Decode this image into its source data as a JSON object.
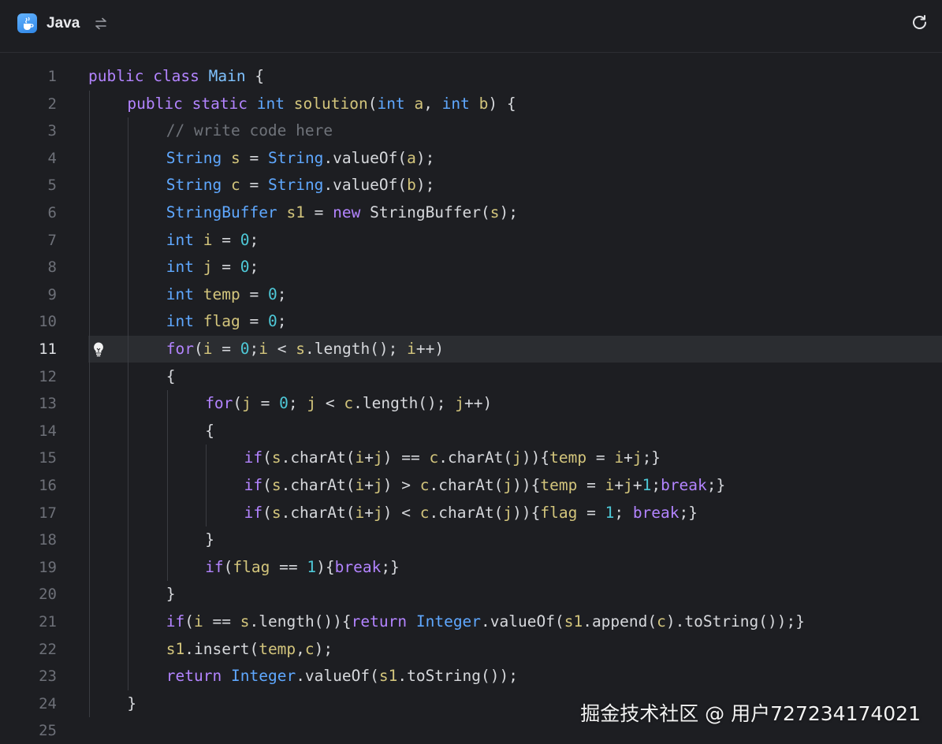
{
  "header": {
    "language_label": "Java",
    "language_icon": "java-cup-icon",
    "switch_icon": "swap-arrows-icon",
    "reset_icon": "refresh-icon"
  },
  "editor": {
    "current_line": 11,
    "hint_icon": "lightbulb-icon",
    "lines": [
      {
        "n": "1",
        "indent": 0,
        "tokens": [
          [
            "kw",
            "public"
          ],
          [
            "pl",
            " "
          ],
          [
            "kw",
            "class"
          ],
          [
            "pl",
            " "
          ],
          [
            "cls",
            "Main"
          ],
          [
            "pl",
            " {"
          ]
        ]
      },
      {
        "n": "2",
        "indent": 1,
        "tokens": [
          [
            "kw",
            "public"
          ],
          [
            "pl",
            " "
          ],
          [
            "kw",
            "static"
          ],
          [
            "pl",
            " "
          ],
          [
            "type",
            "int"
          ],
          [
            "pl",
            " "
          ],
          [
            "fn",
            "solution"
          ],
          [
            "pl",
            "("
          ],
          [
            "type",
            "int"
          ],
          [
            "pl",
            " "
          ],
          [
            "var",
            "a"
          ],
          [
            "pl",
            ", "
          ],
          [
            "type",
            "int"
          ],
          [
            "pl",
            " "
          ],
          [
            "var",
            "b"
          ],
          [
            "pl",
            ") {"
          ]
        ]
      },
      {
        "n": "3",
        "indent": 2,
        "tokens": [
          [
            "cm",
            "// write code here"
          ]
        ]
      },
      {
        "n": "4",
        "indent": 2,
        "tokens": [
          [
            "type",
            "String"
          ],
          [
            "pl",
            " "
          ],
          [
            "var",
            "s"
          ],
          [
            "pl",
            " = "
          ],
          [
            "type",
            "String"
          ],
          [
            "pl",
            ".valueOf("
          ],
          [
            "var",
            "a"
          ],
          [
            "pl",
            ");"
          ]
        ]
      },
      {
        "n": "5",
        "indent": 2,
        "tokens": [
          [
            "type",
            "String"
          ],
          [
            "pl",
            " "
          ],
          [
            "var",
            "c"
          ],
          [
            "pl",
            " = "
          ],
          [
            "type",
            "String"
          ],
          [
            "pl",
            ".valueOf("
          ],
          [
            "var",
            "b"
          ],
          [
            "pl",
            ");"
          ]
        ]
      },
      {
        "n": "6",
        "indent": 2,
        "tokens": [
          [
            "type",
            "StringBuffer"
          ],
          [
            "pl",
            " "
          ],
          [
            "var",
            "s1"
          ],
          [
            "pl",
            " = "
          ],
          [
            "kw",
            "new"
          ],
          [
            "pl",
            " StringBuffer("
          ],
          [
            "var",
            "s"
          ],
          [
            "pl",
            ");"
          ]
        ]
      },
      {
        "n": "7",
        "indent": 2,
        "tokens": [
          [
            "type",
            "int"
          ],
          [
            "pl",
            " "
          ],
          [
            "var",
            "i"
          ],
          [
            "pl",
            " = "
          ],
          [
            "num",
            "0"
          ],
          [
            "pl",
            ";"
          ]
        ]
      },
      {
        "n": "8",
        "indent": 2,
        "tokens": [
          [
            "type",
            "int"
          ],
          [
            "pl",
            " "
          ],
          [
            "var",
            "j"
          ],
          [
            "pl",
            " = "
          ],
          [
            "num",
            "0"
          ],
          [
            "pl",
            ";"
          ]
        ]
      },
      {
        "n": "9",
        "indent": 2,
        "tokens": [
          [
            "type",
            "int"
          ],
          [
            "pl",
            " "
          ],
          [
            "var",
            "temp"
          ],
          [
            "pl",
            " = "
          ],
          [
            "num",
            "0"
          ],
          [
            "pl",
            ";"
          ]
        ]
      },
      {
        "n": "10",
        "indent": 2,
        "tokens": [
          [
            "type",
            "int"
          ],
          [
            "pl",
            " "
          ],
          [
            "var",
            "flag"
          ],
          [
            "pl",
            " = "
          ],
          [
            "num",
            "0"
          ],
          [
            "pl",
            ";"
          ]
        ]
      },
      {
        "n": "11",
        "indent": 2,
        "tokens": [
          [
            "kw",
            "for"
          ],
          [
            "pl",
            "("
          ],
          [
            "var",
            "i"
          ],
          [
            "pl",
            " = "
          ],
          [
            "num",
            "0"
          ],
          [
            "pl",
            ";"
          ],
          [
            "var",
            "i"
          ],
          [
            "pl",
            " < "
          ],
          [
            "var",
            "s"
          ],
          [
            "pl",
            ".length(); "
          ],
          [
            "var",
            "i"
          ],
          [
            "pl",
            "++)"
          ]
        ]
      },
      {
        "n": "12",
        "indent": 2,
        "tokens": [
          [
            "pl",
            "{"
          ]
        ]
      },
      {
        "n": "13",
        "indent": 3,
        "tokens": [
          [
            "kw",
            "for"
          ],
          [
            "pl",
            "("
          ],
          [
            "var",
            "j"
          ],
          [
            "pl",
            " = "
          ],
          [
            "num",
            "0"
          ],
          [
            "pl",
            "; "
          ],
          [
            "var",
            "j"
          ],
          [
            "pl",
            " < "
          ],
          [
            "var",
            "c"
          ],
          [
            "pl",
            ".length(); "
          ],
          [
            "var",
            "j"
          ],
          [
            "pl",
            "++)"
          ]
        ]
      },
      {
        "n": "14",
        "indent": 3,
        "tokens": [
          [
            "pl",
            "{"
          ]
        ]
      },
      {
        "n": "15",
        "indent": 4,
        "tokens": [
          [
            "kw",
            "if"
          ],
          [
            "pl",
            "("
          ],
          [
            "var",
            "s"
          ],
          [
            "pl",
            ".charAt("
          ],
          [
            "var",
            "i"
          ],
          [
            "pl",
            "+"
          ],
          [
            "var",
            "j"
          ],
          [
            "pl",
            ") == "
          ],
          [
            "var",
            "c"
          ],
          [
            "pl",
            ".charAt("
          ],
          [
            "var",
            "j"
          ],
          [
            "pl",
            "))"
          ],
          [
            "pl",
            "{"
          ],
          [
            "var",
            "temp"
          ],
          [
            "pl",
            " = "
          ],
          [
            "var",
            "i"
          ],
          [
            "pl",
            "+"
          ],
          [
            "var",
            "j"
          ],
          [
            "pl",
            ";}"
          ]
        ]
      },
      {
        "n": "16",
        "indent": 4,
        "tokens": [
          [
            "kw",
            "if"
          ],
          [
            "pl",
            "("
          ],
          [
            "var",
            "s"
          ],
          [
            "pl",
            ".charAt("
          ],
          [
            "var",
            "i"
          ],
          [
            "pl",
            "+"
          ],
          [
            "var",
            "j"
          ],
          [
            "pl",
            ") > "
          ],
          [
            "var",
            "c"
          ],
          [
            "pl",
            ".charAt("
          ],
          [
            "var",
            "j"
          ],
          [
            "pl",
            "))"
          ],
          [
            "pl",
            "{"
          ],
          [
            "var",
            "temp"
          ],
          [
            "pl",
            " = "
          ],
          [
            "var",
            "i"
          ],
          [
            "pl",
            "+"
          ],
          [
            "var",
            "j"
          ],
          [
            "pl",
            "+"
          ],
          [
            "num",
            "1"
          ],
          [
            "pl",
            ";"
          ],
          [
            "kw",
            "break"
          ],
          [
            "pl",
            ";}"
          ]
        ]
      },
      {
        "n": "17",
        "indent": 4,
        "tokens": [
          [
            "kw",
            "if"
          ],
          [
            "pl",
            "("
          ],
          [
            "var",
            "s"
          ],
          [
            "pl",
            ".charAt("
          ],
          [
            "var",
            "i"
          ],
          [
            "pl",
            "+"
          ],
          [
            "var",
            "j"
          ],
          [
            "pl",
            ") < "
          ],
          [
            "var",
            "c"
          ],
          [
            "pl",
            ".charAt("
          ],
          [
            "var",
            "j"
          ],
          [
            "pl",
            "))"
          ],
          [
            "pl",
            "{"
          ],
          [
            "var",
            "flag"
          ],
          [
            "pl",
            " = "
          ],
          [
            "num",
            "1"
          ],
          [
            "pl",
            "; "
          ],
          [
            "kw",
            "break"
          ],
          [
            "pl",
            ";}"
          ]
        ]
      },
      {
        "n": "18",
        "indent": 3,
        "tokens": [
          [
            "pl",
            "}"
          ]
        ]
      },
      {
        "n": "19",
        "indent": 3,
        "tokens": [
          [
            "kw",
            "if"
          ],
          [
            "pl",
            "("
          ],
          [
            "var",
            "flag"
          ],
          [
            "pl",
            " == "
          ],
          [
            "num",
            "1"
          ],
          [
            "pl",
            ")"
          ],
          [
            "pl",
            "{"
          ],
          [
            "kw",
            "break"
          ],
          [
            "pl",
            ";}"
          ]
        ]
      },
      {
        "n": "20",
        "indent": 2,
        "tokens": [
          [
            "pl",
            "}"
          ]
        ]
      },
      {
        "n": "21",
        "indent": 2,
        "tokens": [
          [
            "kw",
            "if"
          ],
          [
            "pl",
            "("
          ],
          [
            "var",
            "i"
          ],
          [
            "pl",
            " == "
          ],
          [
            "var",
            "s"
          ],
          [
            "pl",
            ".length())"
          ],
          [
            "pl",
            "{"
          ],
          [
            "kw",
            "return"
          ],
          [
            "pl",
            " "
          ],
          [
            "type",
            "Integer"
          ],
          [
            "pl",
            ".valueOf("
          ],
          [
            "var",
            "s1"
          ],
          [
            "pl",
            ".append("
          ],
          [
            "var",
            "c"
          ],
          [
            "pl",
            ").toString());}"
          ]
        ]
      },
      {
        "n": "22",
        "indent": 2,
        "tokens": [
          [
            "var",
            "s1"
          ],
          [
            "pl",
            ".insert("
          ],
          [
            "var",
            "temp"
          ],
          [
            "pl",
            ","
          ],
          [
            "var",
            "c"
          ],
          [
            "pl",
            ");"
          ]
        ]
      },
      {
        "n": "23",
        "indent": 2,
        "tokens": [
          [
            "kw",
            "return"
          ],
          [
            "pl",
            " "
          ],
          [
            "type",
            "Integer"
          ],
          [
            "pl",
            ".valueOf("
          ],
          [
            "var",
            "s1"
          ],
          [
            "pl",
            ".toString());"
          ]
        ]
      },
      {
        "n": "24",
        "indent": 1,
        "tokens": [
          [
            "pl",
            "}"
          ]
        ]
      },
      {
        "n": "25",
        "indent": 0,
        "tokens": []
      }
    ]
  },
  "watermark": "掘金技术社区 @ 用户727234174021",
  "colors": {
    "background": "#1d1e22",
    "keyword": "#b384ff",
    "type": "#5fa8ff",
    "identifier": "#d3c57c",
    "number": "#4ec9d8",
    "comment": "#6f737a",
    "line_highlight": "#2b2d31"
  }
}
